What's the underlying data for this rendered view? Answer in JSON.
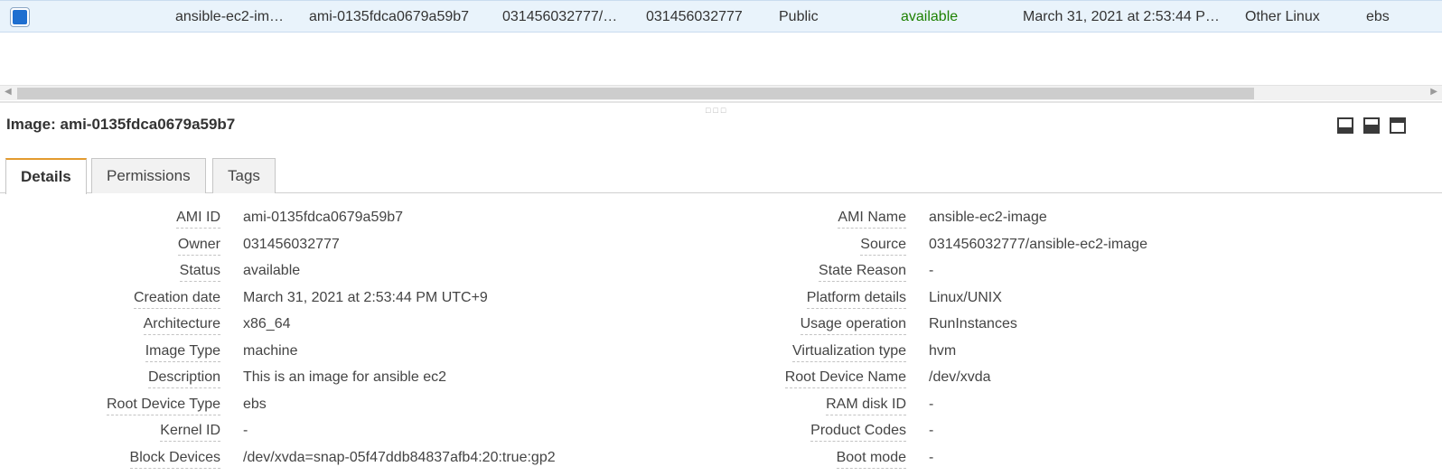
{
  "selected_row": {
    "cells": [
      "ansible-ec2-im…",
      "ami-0135fdca0679a59b7",
      "031456032777/…",
      "031456032777",
      "Public",
      "available",
      "March 31, 2021 at 2:53:44 P…",
      "Other Linux",
      "ebs"
    ]
  },
  "detail": {
    "title": "Image: ami-0135fdca0679a59b7",
    "tabs": [
      {
        "label": "Details",
        "active": true
      },
      {
        "label": "Permissions",
        "active": false
      },
      {
        "label": "Tags",
        "active": false
      }
    ],
    "left": [
      {
        "label": "AMI ID",
        "value": "ami-0135fdca0679a59b7"
      },
      {
        "label": "Owner",
        "value": "031456032777"
      },
      {
        "label": "Status",
        "value": "available"
      },
      {
        "label": "Creation date",
        "value": "March 31, 2021 at 2:53:44 PM UTC+9"
      },
      {
        "label": "Architecture",
        "value": "x86_64"
      },
      {
        "label": "Image Type",
        "value": "machine"
      },
      {
        "label": "Description",
        "value": "This is an image for ansible ec2"
      },
      {
        "label": "Root Device Type",
        "value": "ebs"
      },
      {
        "label": "Kernel ID",
        "value": "-"
      },
      {
        "label": "Block Devices",
        "value": "/dev/xvda=snap-05f47ddb84837afb4:20:true:gp2"
      }
    ],
    "right": [
      {
        "label": "AMI Name",
        "value": "ansible-ec2-image"
      },
      {
        "label": "Source",
        "value": "031456032777/ansible-ec2-image"
      },
      {
        "label": "State Reason",
        "value": "-"
      },
      {
        "label": "Platform details",
        "value": "Linux/UNIX"
      },
      {
        "label": "Usage operation",
        "value": "RunInstances"
      },
      {
        "label": "Virtualization type",
        "value": "hvm"
      },
      {
        "label": "Root Device Name",
        "value": "/dev/xvda"
      },
      {
        "label": "RAM disk ID",
        "value": "-"
      },
      {
        "label": "Product Codes",
        "value": "-"
      },
      {
        "label": "Boot mode",
        "value": "-"
      }
    ]
  },
  "colors": {
    "selected_row_bg": "#e9f3fb",
    "checkbox": "#1e6fd0",
    "available": "#1d8102",
    "active_tab_accent": "#e39b2f"
  },
  "icons": [
    "checkbox-checked-icon",
    "scroll-left-icon",
    "scroll-right-icon",
    "resize-grip-icon",
    "layout-bottom-icon",
    "layout-split-icon",
    "layout-top-icon"
  ]
}
